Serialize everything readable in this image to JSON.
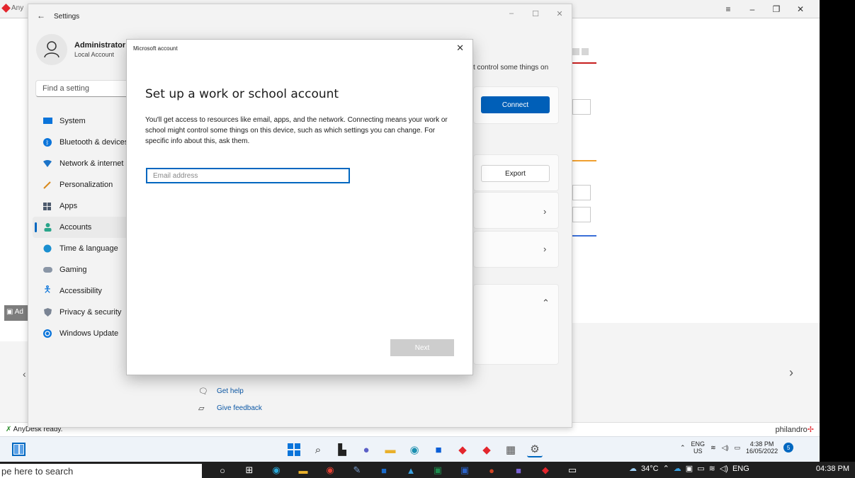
{
  "anydesk": {
    "tab_label": "Any",
    "status_text": "AnyDesk ready.",
    "brand": "philandro",
    "side_label": "Ad"
  },
  "settings": {
    "window_title": "Settings",
    "user_name": "Administrator",
    "user_type": "Local Account",
    "find_placeholder": "Find a setting",
    "nav_items": [
      {
        "label": "System",
        "icon": "monitor-icon"
      },
      {
        "label": "Bluetooth & devices",
        "icon": "bluetooth-icon"
      },
      {
        "label": "Network & internet",
        "icon": "wifi-icon"
      },
      {
        "label": "Personalization",
        "icon": "brush-icon"
      },
      {
        "label": "Apps",
        "icon": "apps-icon"
      },
      {
        "label": "Accounts",
        "icon": "person-icon"
      },
      {
        "label": "Time & language",
        "icon": "globe-clock-icon"
      },
      {
        "label": "Gaming",
        "icon": "controller-icon"
      },
      {
        "label": "Accessibility",
        "icon": "accessibility-icon"
      },
      {
        "label": "Privacy & security",
        "icon": "shield-icon"
      },
      {
        "label": "Windows Update",
        "icon": "update-icon"
      }
    ],
    "active_nav": "Accounts",
    "desc_peek": "t control some things on",
    "connect_label": "Connect",
    "export_label": "Export",
    "help_label": "Get help",
    "feedback_label": "Give feedback"
  },
  "dialog": {
    "title": "Microsoft account",
    "heading": "Set up a work or school account",
    "body": "You'll get access to resources like email, apps, and the network. Connecting means your work or school might control some things on this device, such as which settings you can change. For specific info about this, ask them.",
    "email_placeholder": "Email address",
    "next_label": "Next"
  },
  "remote_taskbar": {
    "lang_top": "ENG",
    "lang_bottom": "US",
    "time": "4:38 PM",
    "date": "16/05/2022",
    "notif_count": "5"
  },
  "local_taskbar": {
    "search_text": "pe here to search",
    "temperature": "34°C",
    "language": "ENG",
    "clock": "04:38 PM"
  },
  "colors": {
    "accent": "#0067c0",
    "connect_bg": "#005fb8",
    "anydesk_red": "#e3262d"
  }
}
